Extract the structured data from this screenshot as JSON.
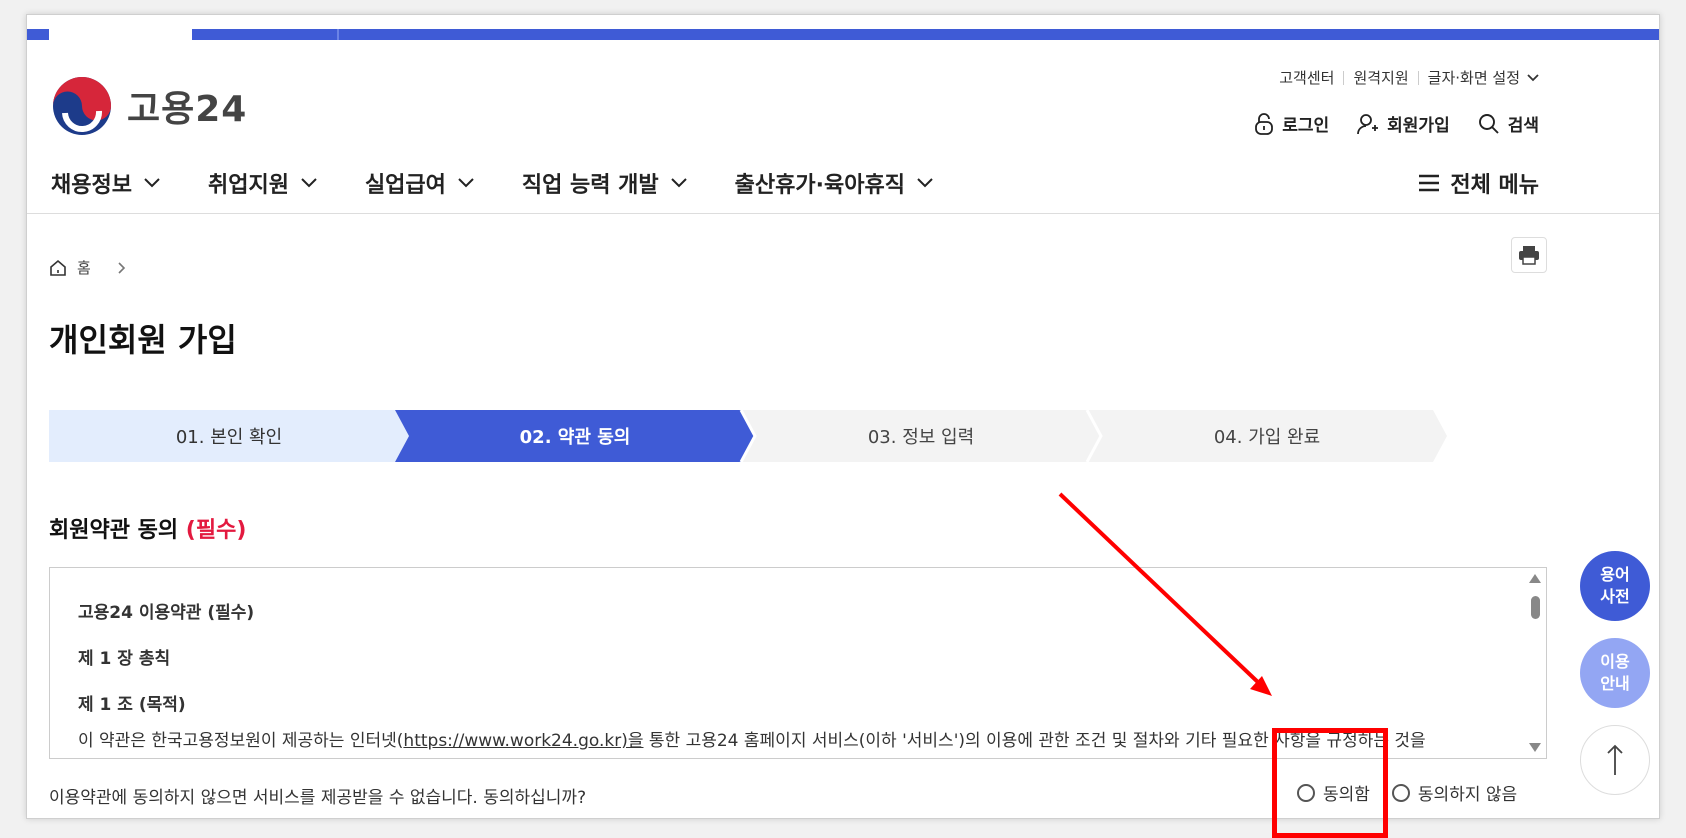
{
  "util_menu": {
    "customer_center": "고객센터",
    "remote_support": "원격지원",
    "display_settings": "글자·화면 설정"
  },
  "logo": {
    "text": "고용24"
  },
  "account_menu": {
    "login": "로그인",
    "signup": "회원가입",
    "search": "검색"
  },
  "gnb": {
    "items": [
      {
        "label": "채용정보"
      },
      {
        "label": "취업지원"
      },
      {
        "label": "실업급여"
      },
      {
        "label": "직업 능력 개발"
      },
      {
        "label": "출산휴가·육아휴직"
      }
    ],
    "all_menu": "전체 메뉴"
  },
  "breadcrumb": {
    "home": "홈"
  },
  "page": {
    "title": "개인회원 가입"
  },
  "steps": [
    {
      "label": "01. 본인 확인",
      "state": "done"
    },
    {
      "label": "02. 약관 동의",
      "state": "active"
    },
    {
      "label": "03. 정보 입력",
      "state": "todo"
    },
    {
      "label": "04. 가입 완료",
      "state": "todo"
    }
  ],
  "terms_section": {
    "heading": "회원약관 동의",
    "required_tag": "(필수)",
    "doc_title": "고용24 이용약관 (필수)",
    "chapter": "제 1 장 총칙",
    "article": "제 1 조 (목적)",
    "body_prefix": "이 약관은 한국고용정보원이 제공하는 인터넷(",
    "body_link": "https://www.work24.go.kr)을",
    "body_suffix": " 통한 고용24 홈페이지 서비스(이하 '서비스')의 이용에 관한 조건 및 절차와 기타 필요한 사항을 규정하는 것을",
    "question": "이용약관에 동의하지 않으면 서비스를 제공받을 수 없습니다. 동의하십니까?",
    "agree": "동의함",
    "disagree": "동의하지 않음"
  },
  "floating": {
    "glossary_line1": "용어",
    "glossary_line2": "사전",
    "guide_line1": "이용",
    "guide_line2": "안내"
  },
  "colors": {
    "brand_blue": "#3f5bd6",
    "step_done_bg": "#e3edfd",
    "step_todo_bg": "#f3f3f3",
    "required_red": "#e3193f",
    "annotation_red": "#ff0000"
  }
}
